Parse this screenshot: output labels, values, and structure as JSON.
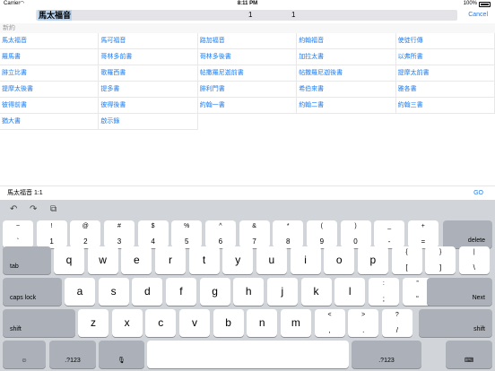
{
  "status_bar": {
    "carrier": "Carrier",
    "time": "8:11 PM",
    "battery": "100%"
  },
  "search": {
    "book": "馬太福音",
    "chapter": "1",
    "verse": "1",
    "cancel_label": "Cancel"
  },
  "section_header": "新約",
  "books": [
    "馬太福音",
    "馬可福音",
    "路加福音",
    "約翰福音",
    "使徒行傳",
    "羅馬書",
    "哥林多前書",
    "哥林多後書",
    "加拉太書",
    "以弗所書",
    "腓立比書",
    "歌羅西書",
    "帖撒羅尼迦前書",
    "帖撒羅尼迦後書",
    "提摩太前書",
    "提摩太後書",
    "提多書",
    "腓利門書",
    "希伯來書",
    "雅各書",
    "彼得前書",
    "彼得後書",
    "約翰一書",
    "約翰二書",
    "約翰三書",
    "猶大書",
    "啟示錄"
  ],
  "verse_bar": {
    "reference": "馬太福音 1:1",
    "go_label": "GO"
  },
  "keyboard": {
    "tools": {
      "undo": "↶",
      "redo": "↷",
      "paste": "⧉"
    },
    "number_row": [
      [
        "~",
        "`"
      ],
      [
        "!",
        "1"
      ],
      [
        "@",
        "2"
      ],
      [
        "#",
        "3"
      ],
      [
        "$",
        "4"
      ],
      [
        "%",
        "5"
      ],
      [
        "^",
        "6"
      ],
      [
        "&",
        "7"
      ],
      [
        "*",
        "8"
      ],
      [
        "(",
        "9"
      ],
      [
        ")",
        "0"
      ],
      [
        "_",
        "-"
      ],
      [
        "+",
        "="
      ]
    ],
    "delete": "delete",
    "tab": "tab",
    "row_q": [
      "q",
      "w",
      "e",
      "r",
      "t",
      "y",
      "u",
      "i",
      "o",
      "p"
    ],
    "row_q_extra": [
      [
        "{",
        "["
      ],
      [
        "}",
        "]"
      ],
      [
        "|",
        "\\"
      ]
    ],
    "caps_lock": "caps lock",
    "row_a": [
      "a",
      "s",
      "d",
      "f",
      "g",
      "h",
      "j",
      "k",
      "l"
    ],
    "row_a_extra": [
      [
        ":",
        ";"
      ],
      [
        "”",
        "“"
      ]
    ],
    "next": "Next",
    "shift": "shift",
    "row_z": [
      "z",
      "x",
      "c",
      "v",
      "b",
      "n",
      "m"
    ],
    "row_z_extra": [
      [
        "<",
        ","
      ],
      [
        ">",
        "."
      ],
      [
        "?",
        "/"
      ]
    ],
    "emoji": "☺",
    "numbers_switch": ".?123",
    "mic": "🎙",
    "hide_keyboard": "⌨"
  }
}
